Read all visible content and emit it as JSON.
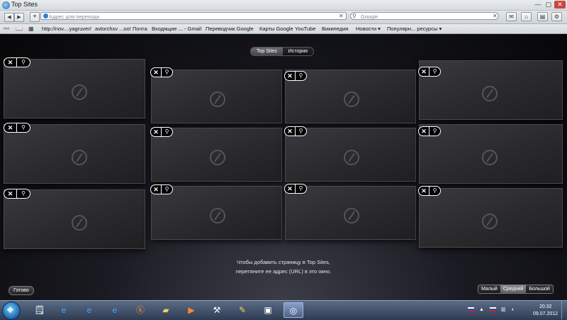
{
  "window": {
    "title": "Top Sites",
    "min": "—",
    "max": "▢",
    "close": "✕"
  },
  "toolbar": {
    "back": "◀",
    "forward": "▶",
    "add": "+",
    "address_placeholder": "Адрес для перехода",
    "address_clear": "✕",
    "search_placeholder": "Google",
    "search_clear": "✕",
    "icons": [
      "mail-icon",
      "home-icon",
      "page-icon",
      "gear-icon"
    ]
  },
  "bookmarks": {
    "items": [
      "http://nov....yagruver/",
      "avtorchsv ...oo! Почта",
      "Входящие ... - Gmail",
      "Переводчик Google",
      "Карты Google",
      "YouTube",
      "Википедия",
      "Новости ▾",
      "Популярн... ресурсы ▾"
    ]
  },
  "topsites": {
    "tabs": [
      {
        "label": "Top Sites",
        "active": true
      },
      {
        "label": "История",
        "active": false
      }
    ],
    "hint_line1": "Чтобы добавить страницу в Top Sites,",
    "hint_line2": "перетяните ее адрес (URL) в это окно.",
    "done_label": "Готово",
    "sizes": [
      {
        "label": "Малый",
        "active": false
      },
      {
        "label": "Средний",
        "active": true
      },
      {
        "label": "Большой",
        "active": false
      }
    ],
    "remove_glyph": "✕",
    "pin_glyph": "📌"
  },
  "taskbar": {
    "apps": [
      "notepad-icon",
      "ie-icon",
      "ie-icon",
      "ie-icon",
      "odnoklassniki-icon",
      "folder-icon",
      "media-player-icon",
      "tools-icon",
      "paint-icon",
      "asrock-icon",
      "safari-icon"
    ],
    "time": "20:32",
    "date": "09.07.2012"
  }
}
